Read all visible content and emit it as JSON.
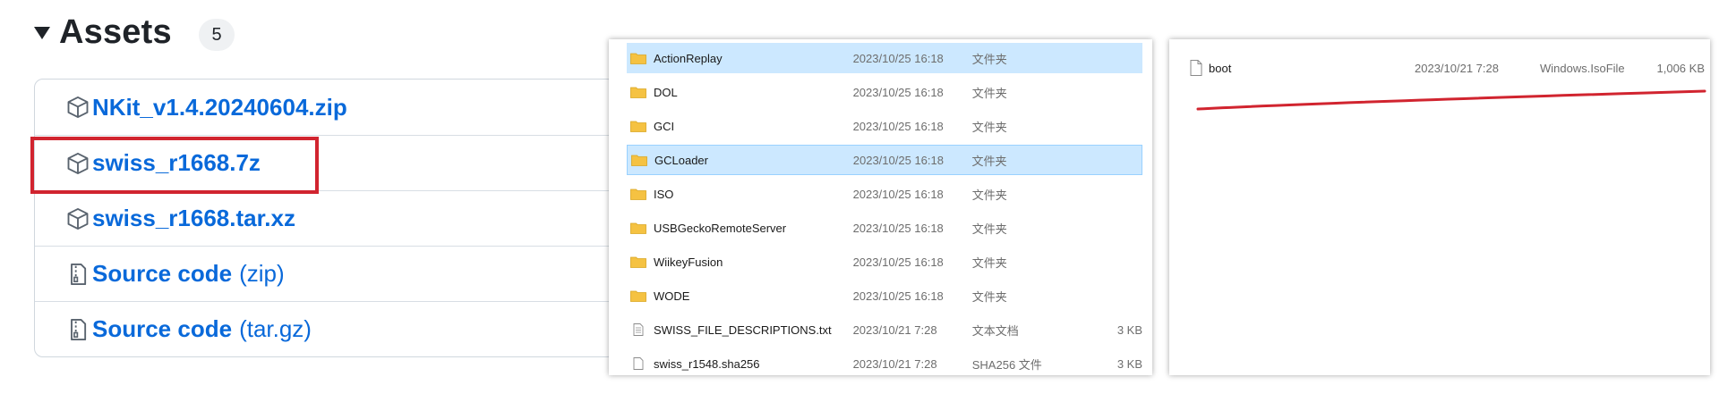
{
  "assets": {
    "title": "Assets",
    "count": "5",
    "items": [
      {
        "name": "NKit_v1.4.20240604.zip",
        "suffix": "",
        "icon": "package-icon"
      },
      {
        "name": "swiss_r1668.7z",
        "suffix": "",
        "icon": "package-icon"
      },
      {
        "name": "swiss_r1668.tar.xz",
        "suffix": "",
        "icon": "package-icon"
      },
      {
        "name": "Source code",
        "suffix": "(zip)",
        "icon": "file-zip-icon"
      },
      {
        "name": "Source code",
        "suffix": "(tar.gz)",
        "icon": "file-zip-icon"
      }
    ],
    "highlight_color": "#d1242f",
    "link_color": "#0969da"
  },
  "explorer_folder": {
    "rows": [
      {
        "name": "ActionReplay",
        "date": "2023/10/25 16:18",
        "type": "文件夹",
        "size": "",
        "icon": "folder-icon",
        "selected": true
      },
      {
        "name": "DOL",
        "date": "2023/10/25 16:18",
        "type": "文件夹",
        "size": "",
        "icon": "folder-icon",
        "selected": false
      },
      {
        "name": "GCI",
        "date": "2023/10/25 16:18",
        "type": "文件夹",
        "size": "",
        "icon": "folder-icon",
        "selected": false
      },
      {
        "name": "GCLoader",
        "date": "2023/10/25 16:18",
        "type": "文件夹",
        "size": "",
        "icon": "folder-icon",
        "selected": true
      },
      {
        "name": "ISO",
        "date": "2023/10/25 16:18",
        "type": "文件夹",
        "size": "",
        "icon": "folder-icon",
        "selected": false
      },
      {
        "name": "USBGeckoRemoteServer",
        "date": "2023/10/25 16:18",
        "type": "文件夹",
        "size": "",
        "icon": "folder-icon",
        "selected": false
      },
      {
        "name": "WiikeyFusion",
        "date": "2023/10/25 16:18",
        "type": "文件夹",
        "size": "",
        "icon": "folder-icon",
        "selected": false
      },
      {
        "name": "WODE",
        "date": "2023/10/25 16:18",
        "type": "文件夹",
        "size": "",
        "icon": "folder-icon",
        "selected": false
      },
      {
        "name": "SWISS_FILE_DESCRIPTIONS.txt",
        "date": "2023/10/21 7:28",
        "type": "文本文档",
        "size": "3 KB",
        "icon": "text-file-icon",
        "selected": false
      },
      {
        "name": "swiss_r1548.sha256",
        "date": "2023/10/21 7:28",
        "type": "SHA256 文件",
        "size": "3 KB",
        "icon": "file-icon",
        "selected": false
      }
    ],
    "selection_color": "#cce8ff",
    "folder_color": "#f5c242"
  },
  "explorer_boot": {
    "row": {
      "name": "boot",
      "date": "2023/10/21 7:28",
      "type": "Windows.IsoFile",
      "size": "1,006 KB",
      "icon": "file-icon"
    },
    "underline_color": "#d1242f"
  }
}
